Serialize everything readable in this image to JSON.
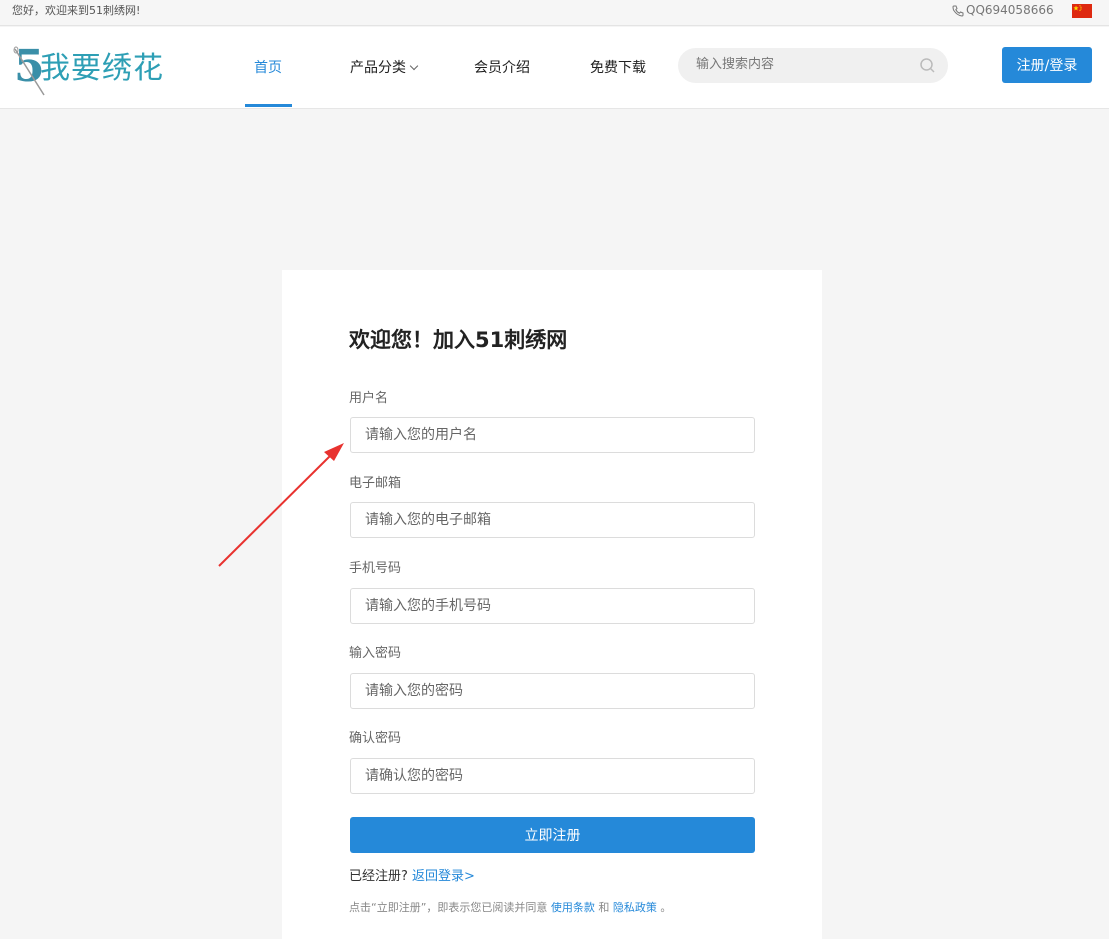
{
  "topbar": {
    "welcome": "您好，欢迎来到51刺绣网!",
    "qq": "QQ694058666",
    "flag_icon": "china-flag-icon"
  },
  "header": {
    "logo_text": "5我要绣花",
    "logo_digit": "5",
    "logo_brand": "我要绣花",
    "nav": [
      {
        "label": "首页",
        "active": true
      },
      {
        "label": "产品分类",
        "has_dropdown": true
      },
      {
        "label": "会员介绍"
      },
      {
        "label": "免费下载"
      }
    ],
    "search_placeholder": "输入搜索内容",
    "login_button": "注册/登录"
  },
  "form": {
    "title": "欢迎您！加入51刺绣网",
    "fields": [
      {
        "label": "用户名",
        "placeholder": "请输入您的用户名"
      },
      {
        "label": "电子邮箱",
        "placeholder": "请输入您的电子邮箱"
      },
      {
        "label": "手机号码",
        "placeholder": "请输入您的手机号码"
      },
      {
        "label": "输入密码",
        "placeholder": "请输入您的密码"
      },
      {
        "label": "确认密码",
        "placeholder": "请确认您的密码"
      }
    ],
    "submit": "立即注册",
    "already_text": "已经注册?",
    "back_login": "返回登录>",
    "terms_prefix": "点击“立即注册”，即表示您已阅读并同意",
    "terms_link1": "使用条款",
    "terms_and": "和",
    "terms_link2": "隐私政策",
    "terms_suffix": "。"
  },
  "colors": {
    "accent": "#2589d9",
    "arrow": "#e8322f",
    "logo": "#2e9fb5"
  }
}
